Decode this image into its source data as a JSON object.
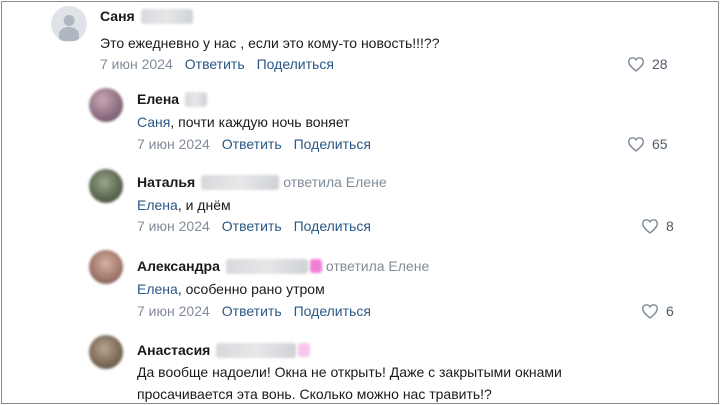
{
  "comments": [
    {
      "author": "Саня",
      "replied_to": "",
      "mention": "",
      "text": "Это ежедневно у нас , если это кому-то новость!!!??",
      "date": "7 июн 2024",
      "reply_label": "Ответить",
      "share_label": "Поделиться",
      "likes": "28"
    },
    {
      "author": "Елена",
      "replied_to": "",
      "mention": "Саня",
      "text": ", почти каждую ночь воняет",
      "date": "7 июн 2024",
      "reply_label": "Ответить",
      "share_label": "Поделиться",
      "likes": "65"
    },
    {
      "author": "Наталья",
      "replied_to": "ответила Елене",
      "mention": "Елена",
      "text": ", и днём",
      "date": "7 июн 2024",
      "reply_label": "Ответить",
      "share_label": "Поделиться",
      "likes": "8"
    },
    {
      "author": "Александра",
      "replied_to": "ответила Елене",
      "mention": "Елена",
      "text": ", особенно рано утром",
      "date": "7 июн 2024",
      "reply_label": "Ответить",
      "share_label": "Поделиться",
      "likes": "6"
    },
    {
      "author": "Анастасия",
      "replied_to": "",
      "mention": "",
      "text_line1": "Да вообще надоели! Окна не открыть! Даже с закрытыми окнами",
      "text_line2": "просачивается эта вонь. Сколько можно нас травить!?"
    }
  ],
  "icons": {
    "like": "heart-icon"
  },
  "colors": {
    "link": "#2a5885",
    "muted": "#818c99",
    "text": "#1a1a1a"
  }
}
